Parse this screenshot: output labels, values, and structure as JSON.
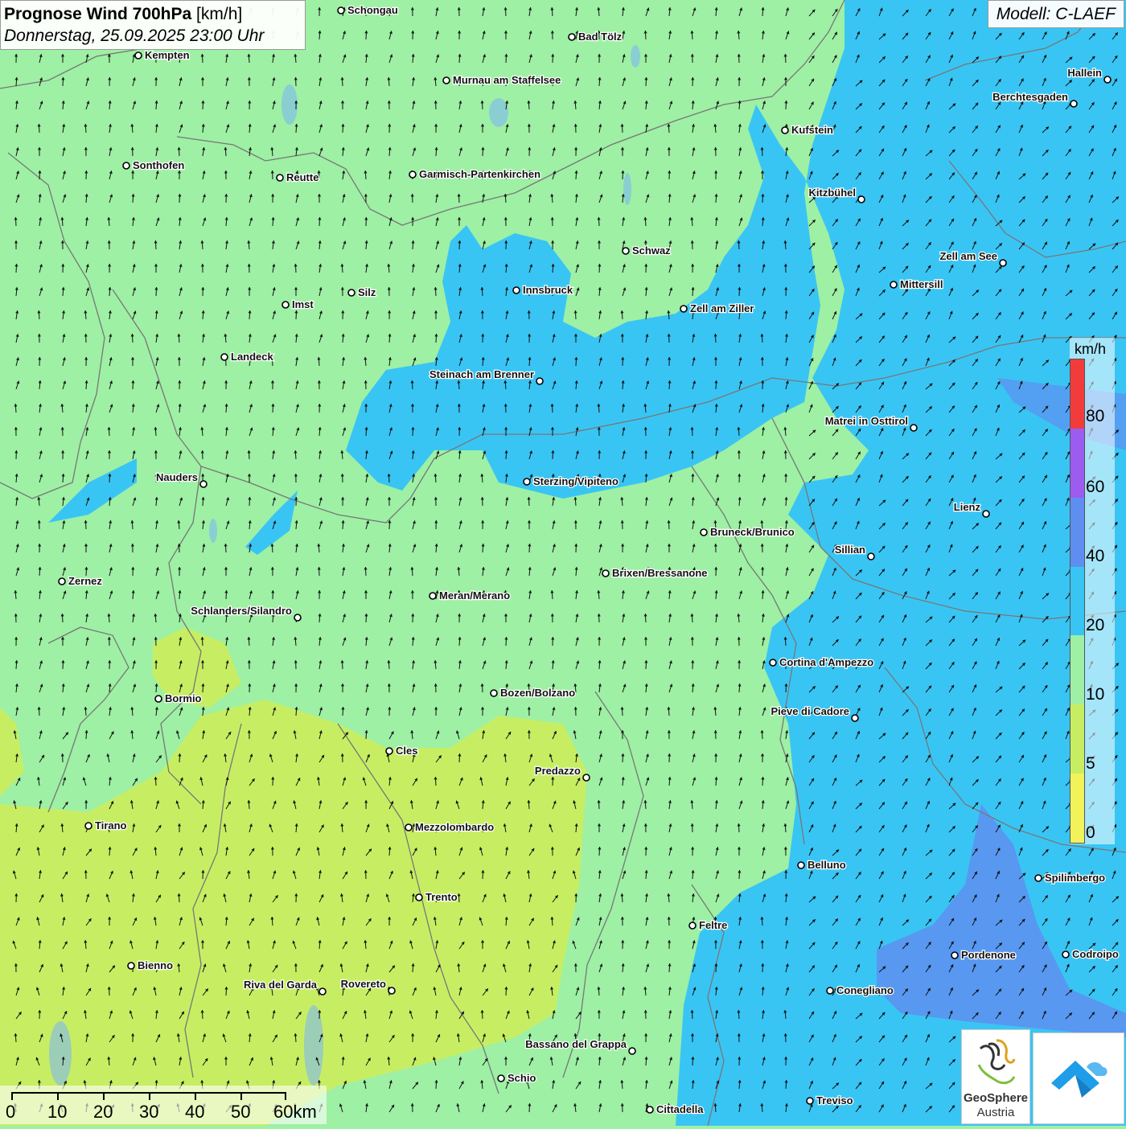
{
  "title": {
    "main": "Prognose Wind 700hPa",
    "unit": "[km/h]",
    "datetime": "Donnerstag, 25.09.2025 23:00 Uhr"
  },
  "model": "Modell: C-LAEF",
  "legend": {
    "unit": "km/h",
    "labels": [
      "80",
      "60",
      "40",
      "20",
      "10",
      "5",
      "0"
    ],
    "colors": [
      "#f23c3c",
      "#9c5cf0",
      "#5e8ff0",
      "#39c5f4",
      "#9ef0a4",
      "#c7ee63",
      "#f2f25a"
    ]
  },
  "scale": {
    "labels": [
      "0",
      "10",
      "20",
      "30",
      "40",
      "50",
      "60km"
    ]
  },
  "logo": {
    "line1": "GeoSphere",
    "line2": "Austria"
  },
  "cities": [
    {
      "name": "Schongau"
    },
    {
      "name": "Bad Tölz"
    },
    {
      "name": "Kempten"
    },
    {
      "name": "Murnau am Staffelsee"
    },
    {
      "name": "Hallein"
    },
    {
      "name": "Berchtesgaden"
    },
    {
      "name": "Kufstein"
    },
    {
      "name": "Sonthofen"
    },
    {
      "name": "Reutte"
    },
    {
      "name": "Garmisch-Partenkirchen"
    },
    {
      "name": "Kitzbühel"
    },
    {
      "name": "Schwaz"
    },
    {
      "name": "Zell am See"
    },
    {
      "name": "Innsbruck"
    },
    {
      "name": "Mittersill"
    },
    {
      "name": "Silz"
    },
    {
      "name": "Imst"
    },
    {
      "name": "Zell am Ziller"
    },
    {
      "name": "Landeck"
    },
    {
      "name": "Steinach am Brenner"
    },
    {
      "name": "Matrei in Osttirol"
    },
    {
      "name": "Nauders"
    },
    {
      "name": "Sterzing/Vipiteno"
    },
    {
      "name": "Lienz"
    },
    {
      "name": "Bruneck/Brunico"
    },
    {
      "name": "Sillian"
    },
    {
      "name": "Zernez"
    },
    {
      "name": "Brixen/Bressanone"
    },
    {
      "name": "Meran/Merano"
    },
    {
      "name": "Schlanders/Silandro"
    },
    {
      "name": "Cortina d'Ampezzo"
    },
    {
      "name": "Bozen/Bolzano"
    },
    {
      "name": "Bormio"
    },
    {
      "name": "Pieve di Cadore"
    },
    {
      "name": "Cles"
    },
    {
      "name": "Predazzo"
    },
    {
      "name": "Tirano"
    },
    {
      "name": "Mezzolombardo"
    },
    {
      "name": "Belluno"
    },
    {
      "name": "Spilimbergo"
    },
    {
      "name": "Trento"
    },
    {
      "name": "Feltre"
    },
    {
      "name": "Pordenone"
    },
    {
      "name": "Codroipo"
    },
    {
      "name": "Bienno"
    },
    {
      "name": "Riva del Garda"
    },
    {
      "name": "Rovereto"
    },
    {
      "name": "Conegliano"
    },
    {
      "name": "Bassano del Grappa"
    },
    {
      "name": "Schio"
    },
    {
      "name": "Treviso"
    },
    {
      "name": "Cittadella"
    }
  ]
}
